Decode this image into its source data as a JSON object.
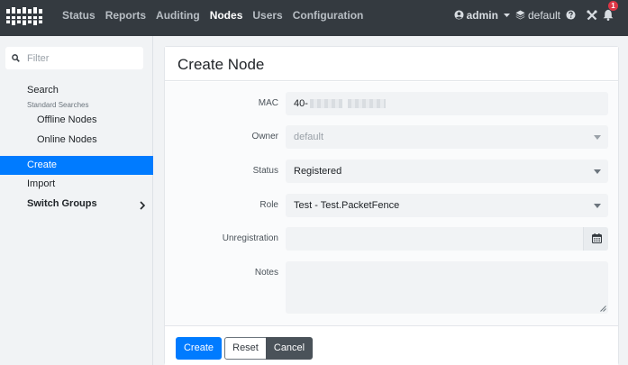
{
  "app": {
    "logo": "packetfence-logo"
  },
  "topnav": {
    "items": [
      {
        "label": "Status",
        "active": false
      },
      {
        "label": "Reports",
        "active": false
      },
      {
        "label": "Auditing",
        "active": false
      },
      {
        "label": "Nodes",
        "active": true
      },
      {
        "label": "Users",
        "active": false
      },
      {
        "label": "Configuration",
        "active": false
      }
    ],
    "user": "admin",
    "tenant": "default",
    "notification_count": "1"
  },
  "sidebar": {
    "filter_placeholder": "Filter",
    "search_label": "Search",
    "standard_searches_heading": "Standard Searches",
    "offline_nodes": "Offline Nodes",
    "online_nodes": "Online Nodes",
    "create": "Create",
    "import": "Import",
    "switch_groups": "Switch Groups"
  },
  "form": {
    "title": "Create Node",
    "mac_label": "MAC",
    "mac_value": "40-",
    "owner_label": "Owner",
    "owner_value": "default",
    "status_label": "Status",
    "status_value": "Registered",
    "role_label": "Role",
    "role_value": "Test - Test.PacketFence",
    "unreg_label": "Unregistration",
    "unreg_value": "",
    "notes_label": "Notes",
    "notes_value": ""
  },
  "buttons": {
    "create": "Create",
    "reset": "Reset",
    "cancel": "Cancel"
  },
  "colors": {
    "navbar": "#343a40",
    "primary": "#007bff",
    "secondary": "#4a5259",
    "danger": "#dc3545"
  }
}
